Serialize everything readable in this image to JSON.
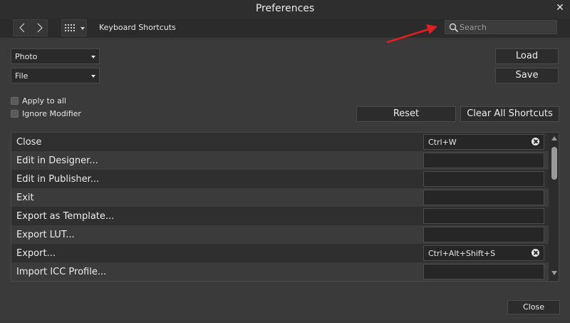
{
  "window": {
    "title": "Preferences",
    "close_glyph": "✕"
  },
  "toolbar": {
    "breadcrumb": "Keyboard Shortcuts",
    "search_placeholder": "Search"
  },
  "filters": {
    "app": "Photo",
    "category": "File"
  },
  "buttons": {
    "load": "Load",
    "save": "Save",
    "reset": "Reset",
    "clear_all": "Clear All Shortcuts",
    "close": "Close"
  },
  "options": [
    {
      "label": "Apply to all",
      "checked": false
    },
    {
      "label": "Ignore Modifier",
      "checked": false
    }
  ],
  "shortcuts": [
    {
      "label": "Close",
      "shortcut": "Ctrl+W"
    },
    {
      "label": "Edit in Designer...",
      "shortcut": ""
    },
    {
      "label": "Edit in Publisher...",
      "shortcut": ""
    },
    {
      "label": "Exit",
      "shortcut": ""
    },
    {
      "label": "Export as Template...",
      "shortcut": ""
    },
    {
      "label": "Export LUT...",
      "shortcut": ""
    },
    {
      "label": "Export...",
      "shortcut": "Ctrl+Alt+Shift+S"
    },
    {
      "label": "Import ICC Profile...",
      "shortcut": ""
    }
  ],
  "colors": {
    "annotation_arrow": "#e02020",
    "background": "#3a3a3a"
  },
  "icons": {
    "back": "chevron-left-icon",
    "forward": "chevron-right-icon",
    "grid": "grid-icon",
    "search": "search-icon",
    "clear": "clear-icon"
  }
}
